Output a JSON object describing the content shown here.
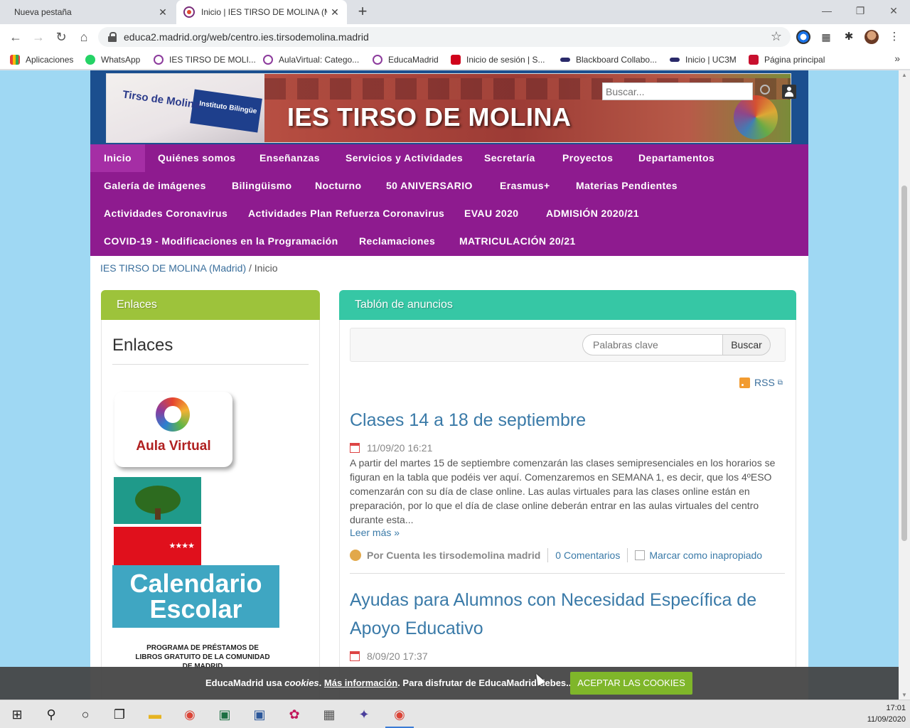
{
  "browser": {
    "tabs": [
      {
        "title": "Nueva pestaña",
        "close": "✕"
      },
      {
        "title": "Inicio | IES TIRSO DE MOLINA (M",
        "close": "✕"
      }
    ],
    "new_tab": "+",
    "window_controls": [
      "—",
      "❐",
      "✕"
    ],
    "url": "educa2.madrid.org/web/centro.ies.tirsodemolina.madrid",
    "nav_icons": [
      "←",
      "→",
      "↻",
      "⌂"
    ],
    "star": "☆",
    "bookmarks": [
      {
        "label": "Aplicaciones",
        "color": "#4285f4"
      },
      {
        "label": "WhatsApp",
        "color": "#25d366"
      },
      {
        "label": "IES TIRSO DE MOLI...",
        "color": "#8c3b9c"
      },
      {
        "label": "AulaVirtual: Catego...",
        "color": "#8c3b9c"
      },
      {
        "label": "EducaMadrid",
        "color": "#8c3b9c"
      },
      {
        "label": "Inicio de sesión | S...",
        "color": "#d0021b"
      },
      {
        "label": "Blackboard Collabo...",
        "color": "#2a2a6a"
      },
      {
        "label": "Inicio | UC3M",
        "color": "#2a2a6a"
      },
      {
        "label": "Página principal",
        "color": "#c8102e"
      }
    ],
    "bookmarks_more": "»"
  },
  "header": {
    "title": "IES TIRSO DE MOLINA",
    "sign_text_1": "Tirso de Molina",
    "sign_text_2": "Instituto Bilingüe",
    "search_placeholder": "Buscar..."
  },
  "nav": {
    "rows": [
      [
        "Inicio",
        "Quiénes somos",
        "Enseñanzas",
        "Servicios y Actividades",
        "Secretaría",
        "Proyectos",
        "Departamentos"
      ],
      [
        "Galería de imágenes",
        "Bilingüismo",
        "Nocturno",
        "50 ANIVERSARIO",
        "Erasmus+",
        "Materias Pendientes"
      ],
      [
        "Actividades Coronavirus",
        "Actividades Plan Refuerza Coronavirus",
        "EVAU 2020",
        "ADMISIÓN 2020/21"
      ],
      [
        "COVID-19 - Modificaciones en la Programación",
        "Reclamaciones",
        "MATRICULACIÓN 20/21"
      ]
    ],
    "active": "Inicio"
  },
  "breadcrumb": {
    "link": "IES TIRSO DE MOLINA (Madrid)",
    "sep": "/",
    "current": "Inicio"
  },
  "enlaces": {
    "header": "Enlaces",
    "title": "Enlaces",
    "aula_virtual": "Aula Virtual",
    "calendario_1": "Calendario",
    "calendario_2": "Escolar",
    "stars": "★★★★",
    "programa": "PROGRAMA DE PRÉSTAMOS DE LIBROS GRATUITO DE LA COMUNIDAD DE MADRID"
  },
  "tablon": {
    "header": "Tablón de anuncios",
    "keyword_placeholder": "Palabras clave",
    "search_button": "Buscar",
    "rss": "RSS",
    "articles": [
      {
        "title": "Clases 14 a 18 de septiembre",
        "date": "11/09/20 16:21",
        "body": "A partir del martes 15 de septiembre comenzarán las clases semipresenciales en los horarios se figuran en la tabla que podéis ver aquí. Comenzaremos en SEMANA 1, es decir, que los 4ºESO comenzarán con su día de clase online.  Las aulas virtuales para las clases online están en preparación, por lo que el día de clase online deberán entrar en las aulas virtuales del centro durante esta...",
        "more": "Leer más »",
        "author": "Por Cuenta Ies tirsodemolina madrid",
        "comments": "0 Comentarios",
        "flag": "Marcar como inapropiado"
      },
      {
        "title_1": "Ayudas para Alumnos con Necesidad Específica de",
        "title_2": "Apoyo Educativo",
        "date": "8/09/20 17:37"
      }
    ]
  },
  "cookie": {
    "text_1": "EducaMadrid usa ",
    "text_2": "cookies",
    "text_3": ". ",
    "link": "Más información",
    "text_4": ". Para disfrutar de EducaMadrid debes...",
    "button": "ACEPTAR LAS COOKIES"
  },
  "taskbar": {
    "time": "17:01",
    "date": "11/09/2020"
  }
}
